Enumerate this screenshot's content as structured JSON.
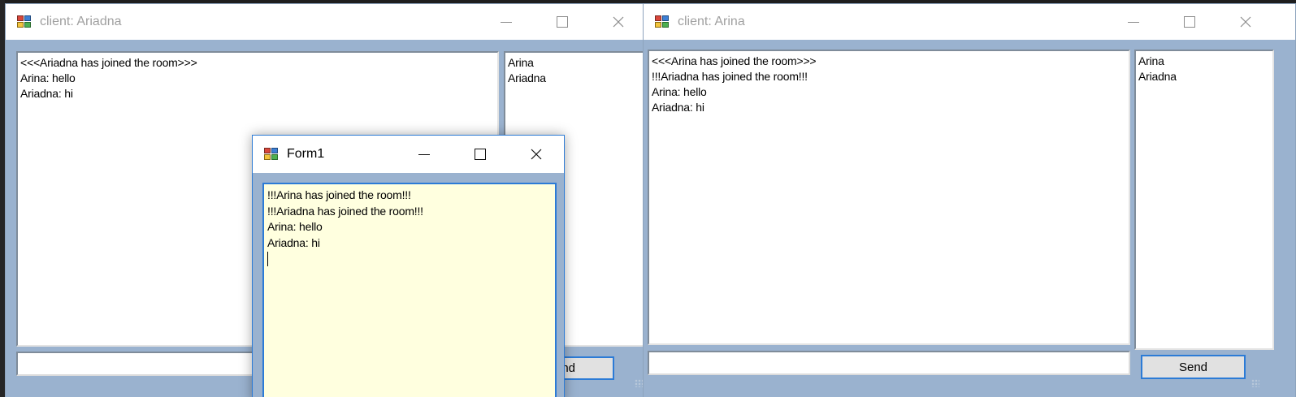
{
  "windows": {
    "ariadna": {
      "title": "client: Ariadna",
      "chat_lines": [
        "<<<Ariadna has joined the room>>>",
        "Arina: hello",
        "Ariadna: hi"
      ],
      "users": [
        "Arina",
        "Ariadna"
      ],
      "message_input_value": "",
      "send_label": "nd"
    },
    "arina": {
      "title": "client: Arina",
      "chat_lines": [
        "<<<Arina has joined the room>>>",
        "!!!Ariadna has joined the room!!!",
        "Arina: hello",
        "Ariadna: hi"
      ],
      "users": [
        "Arina",
        "Ariadna"
      ],
      "message_input_value": "",
      "send_label": "Send"
    },
    "form1": {
      "title": "Form1",
      "log_lines": [
        "!!!Arina has joined the room!!!",
        "!!!Ariadna has joined the room!!!",
        "Arina: hello",
        "Ariadna: hi"
      ]
    }
  },
  "colors": {
    "client_area": "#9ab2cf",
    "focus_accent": "#2c7bd6",
    "server_log_bg": "#ffffdf"
  },
  "icons": [
    "app-form-icon",
    "minimize-icon",
    "maximize-icon",
    "close-icon",
    "resize-grip-icon"
  ]
}
